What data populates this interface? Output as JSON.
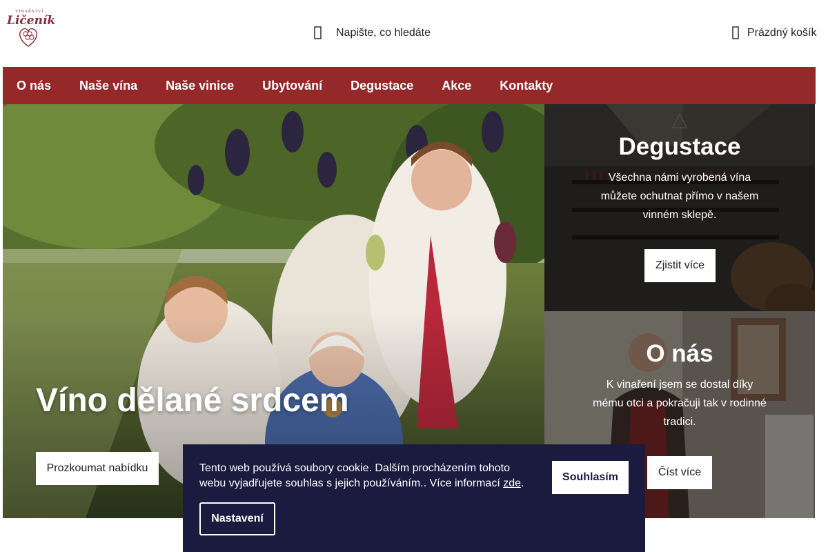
{
  "header": {
    "logo_top_text": "VINAŘSTVÍ",
    "logo_name": "Ličeník",
    "search_label": "Napište, co hledáte",
    "cart_label": "Prázdný košík"
  },
  "nav": {
    "items": [
      {
        "label": "O nás"
      },
      {
        "label": "Naše vína"
      },
      {
        "label": "Naše vinice"
      },
      {
        "label": "Ubytování"
      },
      {
        "label": "Degustace"
      },
      {
        "label": "Akce"
      },
      {
        "label": "Kontakty"
      }
    ]
  },
  "hero": {
    "title": "Víno dělané srdcem",
    "button_label": "Prozkoumat nabídku"
  },
  "panels": {
    "degustace": {
      "title": "Degustace",
      "text": "Všechna námi vyrobená vína můžete ochutnat přímo v našem vinném sklepě.",
      "button_label": "Zjistit více"
    },
    "about": {
      "title": "O nás",
      "text": "K vinaření jsem se dostal díky mému otci a pokračuji tak v rodinné tradici.",
      "button_label": "Číst více"
    }
  },
  "cookie": {
    "message": "Tento web používá soubory cookie. Dalším procházením tohoto webu vyjadřujete souhlas s jejich používáním.. Více informací ",
    "link_label": "zde",
    "message_end": ".",
    "accept_label": "Souhlasím",
    "settings_label": "Nastavení"
  },
  "colors": {
    "nav_bg": "#952929",
    "cookie_bg": "#1b1a3f",
    "brand": "#8a2a3a"
  },
  "icons": {
    "search": "search-icon",
    "cart": "cart-icon",
    "logo": "grape-heart-logo"
  }
}
